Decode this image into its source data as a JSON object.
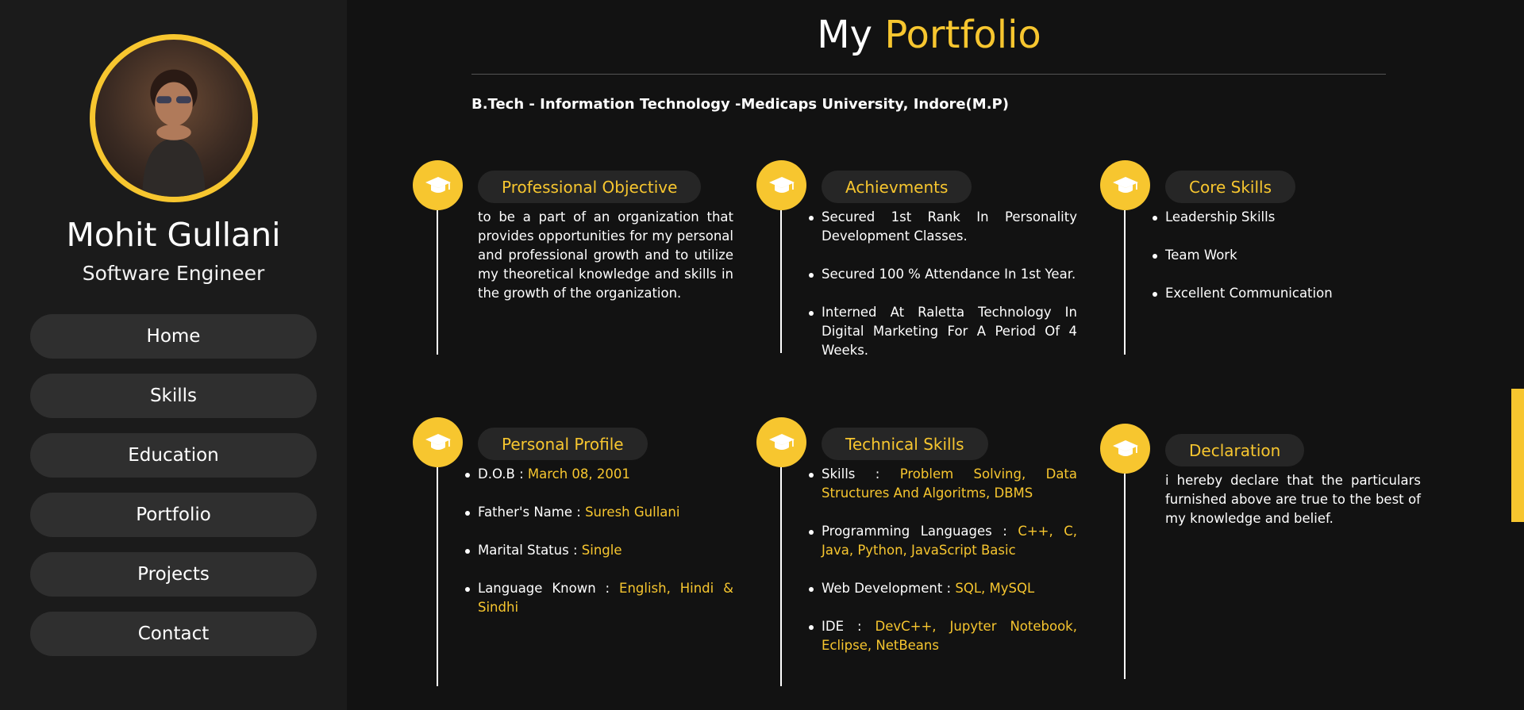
{
  "profile": {
    "name": "Mohit Gullani",
    "role": "Software Engineer"
  },
  "nav": {
    "items": [
      {
        "label": "Home"
      },
      {
        "label": "Skills"
      },
      {
        "label": "Education"
      },
      {
        "label": "Portfolio"
      },
      {
        "label": "Projects"
      },
      {
        "label": "Contact"
      }
    ]
  },
  "header": {
    "title_part1": "My",
    "title_part2": "Portfolio",
    "degree": "B.Tech - Information Technology -Medicaps University, Indore(M.P)"
  },
  "colors": {
    "accent": "#f7c62f",
    "background": "#121212",
    "sidebar": "#1b1b1b",
    "nav_button": "#2f2f2f"
  },
  "icons": {
    "card_icon": "graduation-cap-icon"
  },
  "cards": {
    "objective": {
      "title": "Professional Objective",
      "text": "to be a part of an organization that provides opportunities for my personal and professional growth and to utilize my theoretical knowledge and skills in the growth of the organization."
    },
    "achievements": {
      "title": "Achievments",
      "items": [
        "Secured 1st Rank In Personality Development Classes.",
        "Secured 100 % Attendance In 1st Year.",
        "Interned At Raletta Technology In Digital Marketing For A Period Of 4 Weeks."
      ]
    },
    "core_skills": {
      "title": "Core Skills",
      "items": [
        "Leadership Skills",
        "Team Work",
        "Excellent Communication"
      ]
    },
    "personal": {
      "title": "Personal Profile",
      "items": [
        {
          "label": "D.O.B :",
          "value": "March 08, 2001"
        },
        {
          "label": "Father's Name :",
          "value": "Suresh Gullani"
        },
        {
          "label": "Marital Status :",
          "value": "Single"
        },
        {
          "label": "Language Known :",
          "value": "English, Hindi & Sindhi"
        }
      ]
    },
    "technical": {
      "title": "Technical Skills",
      "items": [
        {
          "label": "Skills :",
          "value": "Problem Solving, Data Structures And Algoritms, DBMS"
        },
        {
          "label": "Programming Languages :",
          "value": "C++, C, Java, Python, JavaScript Basic"
        },
        {
          "label": "Web Development :",
          "value": "SQL, MySQL"
        },
        {
          "label": "IDE :",
          "value": "DevC++, Jupyter Notebook, Eclipse, NetBeans"
        }
      ]
    },
    "declaration": {
      "title": "Declaration",
      "text": "i hereby declare that the particulars furnished above are true to the best of my knowledge and belief."
    }
  }
}
